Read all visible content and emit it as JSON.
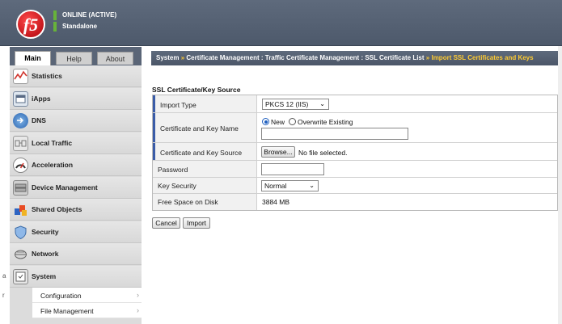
{
  "header": {
    "logo_text": "f5",
    "status_line1": "ONLINE (ACTIVE)",
    "status_line2": "Standalone"
  },
  "tabs": [
    {
      "label": "Main"
    },
    {
      "label": "Help"
    },
    {
      "label": "About"
    }
  ],
  "nav": {
    "items": [
      {
        "label": "Statistics",
        "icon": "statistics-icon"
      },
      {
        "label": "iApps",
        "icon": "iapps-icon"
      },
      {
        "label": "DNS",
        "icon": "dns-icon"
      },
      {
        "label": "Local Traffic",
        "icon": "local-traffic-icon"
      },
      {
        "label": "Acceleration",
        "icon": "acceleration-icon"
      },
      {
        "label": "Device Management",
        "icon": "device-management-icon"
      },
      {
        "label": "Shared Objects",
        "icon": "shared-objects-icon"
      },
      {
        "label": "Security",
        "icon": "security-icon"
      },
      {
        "label": "Network",
        "icon": "network-icon"
      },
      {
        "label": "System",
        "icon": "system-icon"
      }
    ],
    "subitems": [
      {
        "label": "Configuration",
        "arrow": "›"
      },
      {
        "label": "File Management",
        "arrow": "›"
      }
    ]
  },
  "breadcrumb": {
    "items": [
      "System",
      "Certificate Management : Traffic Certificate Management : SSL Certificate List"
    ],
    "separator": "»",
    "current": "Import SSL Certificates and Keys"
  },
  "form": {
    "section_title": "SSL Certificate/Key Source",
    "rows": {
      "import_type": {
        "label": "Import Type",
        "value": "PKCS 12 (IIS)"
      },
      "cert_key_name": {
        "label": "Certificate and Key Name",
        "option_new": "New",
        "option_overwrite": "Overwrite Existing",
        "value": ""
      },
      "cert_key_source": {
        "label": "Certificate and Key Source",
        "browse_label": "Browse...",
        "file_status": "No file selected."
      },
      "password": {
        "label": "Password",
        "value": ""
      },
      "key_security": {
        "label": "Key Security",
        "value": "Normal"
      },
      "free_space": {
        "label": "Free Space on Disk",
        "value": "3884 MB"
      }
    },
    "buttons": {
      "cancel": "Cancel",
      "import": "Import"
    }
  },
  "edge_glyphs": [
    "a",
    "r"
  ],
  "colors": {
    "header_bg": "#55616f",
    "required_marker": "#3a5ca8",
    "breadcrumb_highlight": "#ffcc33",
    "status_indicator": "#67b23a"
  }
}
